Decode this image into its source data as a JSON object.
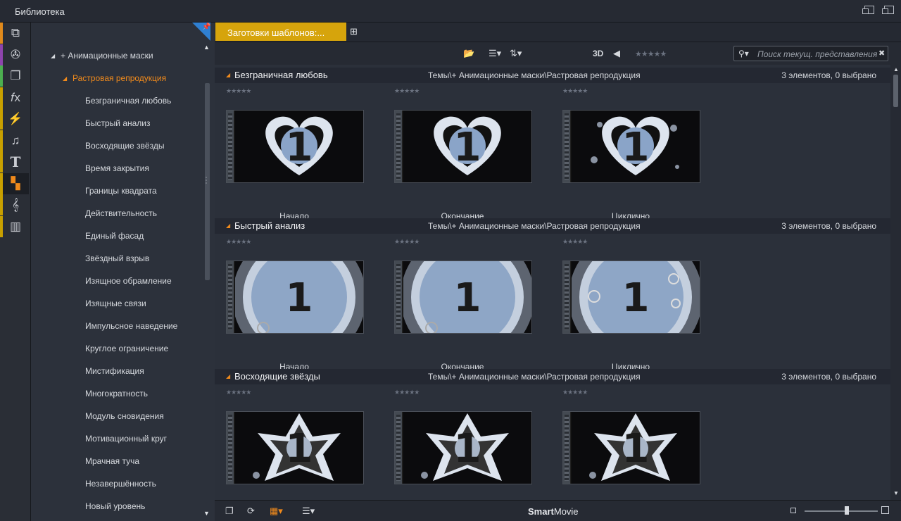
{
  "window": {
    "title": "Библиотека"
  },
  "sidebar_categories": [
    {
      "icon": "layers-icon",
      "color": "#e08a1c"
    },
    {
      "icon": "film-reel-icon",
      "color": "#8e44ad"
    },
    {
      "icon": "photos-icon",
      "color": "#4caf50"
    },
    {
      "icon": "fx-icon",
      "color": "#c8a000"
    },
    {
      "icon": "lightning-icon",
      "color": "#c8a000"
    },
    {
      "icon": "music-note-icon",
      "color": "#c8a000"
    },
    {
      "icon": "text-icon",
      "color": "#c8a000"
    },
    {
      "icon": "montage-icon",
      "color": "#c8a000"
    },
    {
      "icon": "treble-clef-icon",
      "color": "#c8a000"
    },
    {
      "icon": "piano-icon",
      "color": "#c8a000"
    }
  ],
  "tree": {
    "root": "+ Анимационные маски",
    "selected": "Растровая репродукция",
    "items": [
      "Безграничная любовь",
      "Быстрый анализ",
      "Восходящие звёзды",
      "Время закрытия",
      "Границы квадрата",
      "Действительность",
      "Единый фасад",
      "Звёздный взрыв",
      "Изящное обрамление",
      "Изящные связи",
      "Импульсное наведение",
      "Круглое ограничение",
      "Мистификация",
      "Многократность",
      "Модуль сновидения",
      "Мотивационный круг",
      "Мрачная туча",
      "Незавершённость",
      "Новый уровень"
    ]
  },
  "tab": {
    "label": "Заготовки шаблонов:..."
  },
  "toolbar": {
    "view_3d": "3D",
    "stars": "★★★★★",
    "search_placeholder": "Поиск текущ. представления"
  },
  "groups": [
    {
      "name": "Безграничная любовь",
      "path": "Темы\\+ Анимационные маски\\Растровая репродукция",
      "count": "3 элементов, 0 выбрано",
      "items": [
        {
          "label": "Начало",
          "rating": "★★★★★",
          "art": "heart"
        },
        {
          "label": "Окончание",
          "rating": "★★★★★",
          "art": "heart"
        },
        {
          "label": "Циклично",
          "rating": "★★★★★",
          "art": "heart-loop"
        }
      ]
    },
    {
      "name": "Быстрый анализ",
      "path": "Темы\\+ Анимационные маски\\Растровая репродукция",
      "count": "3 элементов, 0 выбрано",
      "items": [
        {
          "label": "Начало",
          "rating": "★★★★★",
          "art": "circle"
        },
        {
          "label": "Окончание",
          "rating": "★★★★★",
          "art": "circle"
        },
        {
          "label": "Циклично",
          "rating": "★★★★★",
          "art": "circle-loop"
        }
      ]
    },
    {
      "name": "Восходящие звёзды",
      "path": "Темы\\+ Анимационные маски\\Растровая репродукция",
      "count": "3 элементов, 0 выбрано",
      "items": [
        {
          "label": "",
          "rating": "★★★★★",
          "art": "star"
        },
        {
          "label": "",
          "rating": "★★★★★",
          "art": "star"
        },
        {
          "label": "",
          "rating": "★★★★★",
          "art": "star"
        }
      ]
    }
  ],
  "thumb_digit": "1",
  "bottom": {
    "brand_bold": "Smart",
    "brand_rest": "Movie",
    "zoom_level": 0.55
  }
}
